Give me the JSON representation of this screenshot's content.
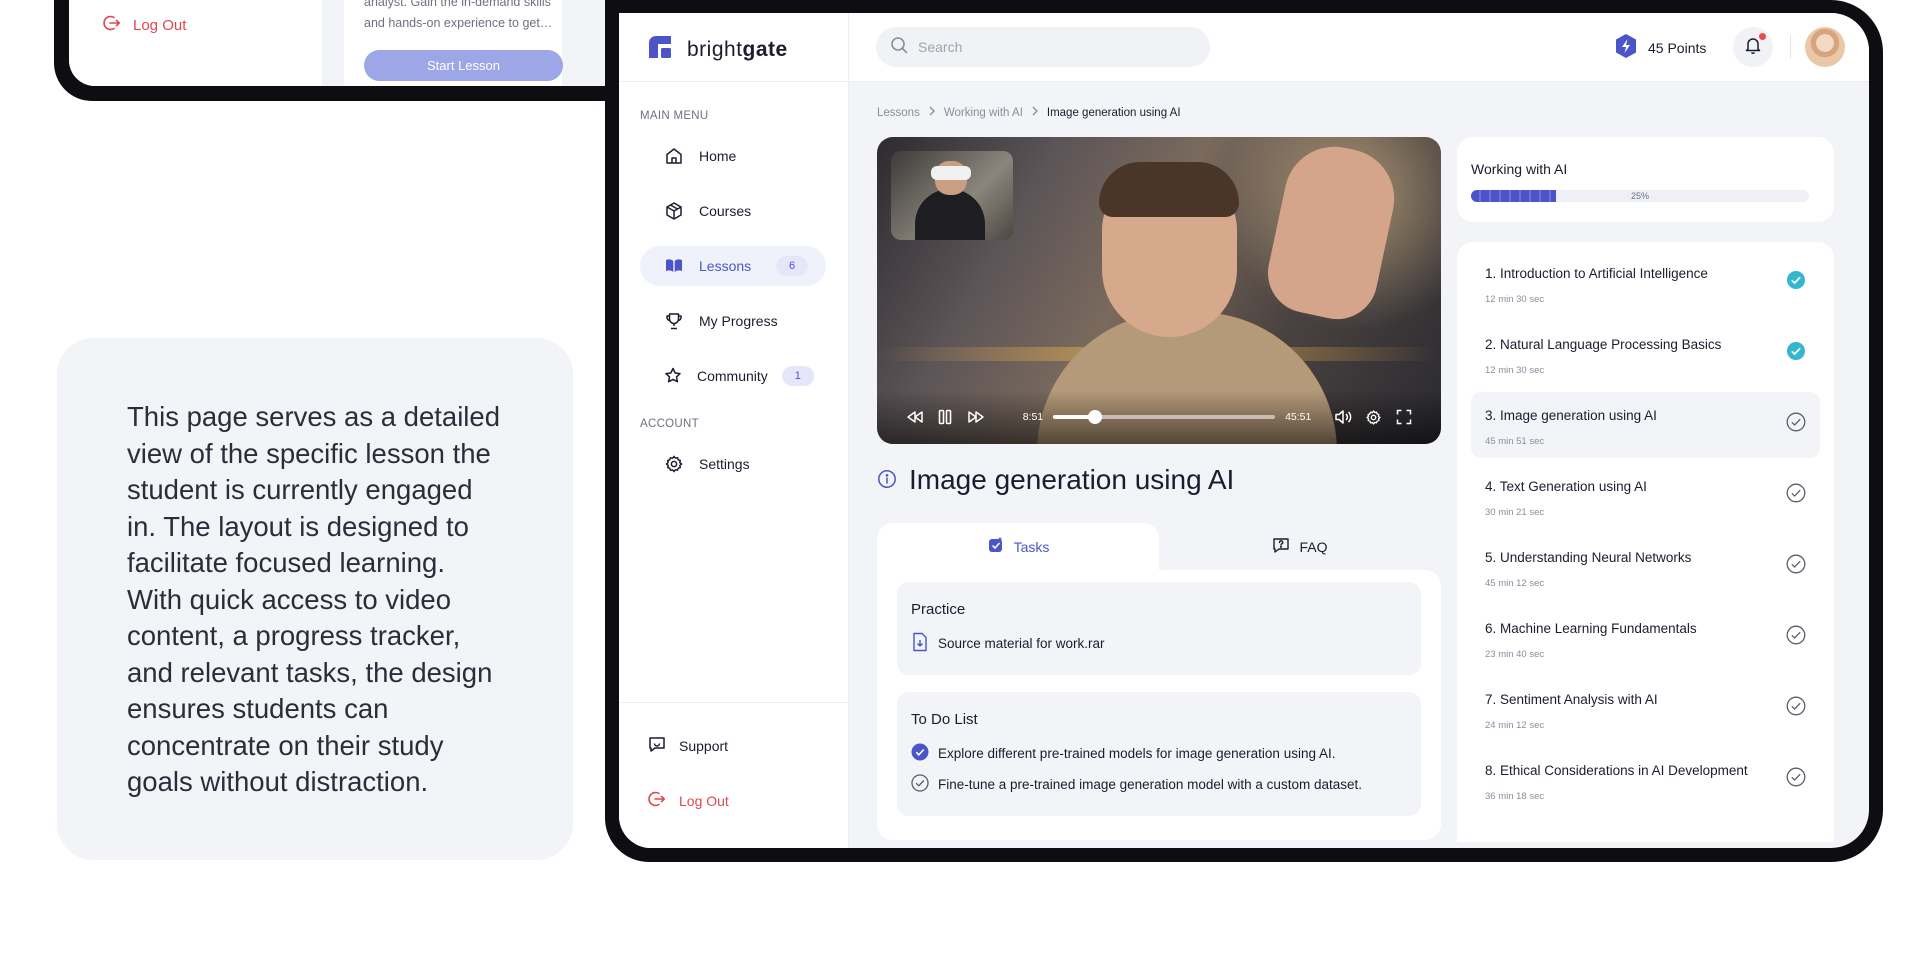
{
  "prev_device": {
    "logout_label": "Log Out",
    "card_text": "analyst. Gain the in-demand skills and hands-on experience to get…",
    "start_button": "Start Lesson"
  },
  "description": "This page serves as a detailed view of the specific lesson the student is currently engaged in. The layout is designed to facilitate focused learning. With quick access to video content, a progress tracker, and relevant tasks, the design ensures students can concentrate on their study goals without distraction.",
  "app": {
    "brand_light": "bright",
    "brand_bold": "gate",
    "accent": "#4b55c8",
    "danger": "#e0464f",
    "success": "#35b6cf",
    "points": "45 Points"
  },
  "sidebar": {
    "main_menu_label": "MAIN MENU",
    "account_label": "ACCOUNT",
    "items": [
      {
        "label": "Home",
        "icon": "home-icon"
      },
      {
        "label": "Courses",
        "icon": "box-icon"
      },
      {
        "label": "Lessons",
        "icon": "book-icon",
        "badge": "6",
        "active": true
      },
      {
        "label": "My Progress",
        "icon": "trophy-icon"
      },
      {
        "label": "Community",
        "icon": "community-icon",
        "badge": "1"
      }
    ],
    "settings": "Settings",
    "support": "Support",
    "logout": "Log Out"
  },
  "search": {
    "placeholder": "Search",
    "value": ""
  },
  "breadcrumb": [
    "Lessons",
    "Working with AI",
    "Image generation using AI"
  ],
  "video": {
    "elapsed": "8:51",
    "total": "45:51",
    "progress": 0.19
  },
  "lesson_title": "Image generation using AI",
  "tabs": {
    "tasks": "Tasks",
    "faq": "FAQ"
  },
  "practice": {
    "title": "Practice",
    "file": "Source material for work.rar"
  },
  "todo": {
    "title": "To Do List",
    "items": [
      {
        "text": "Explore different pre-trained models for image generation using AI.",
        "done": true
      },
      {
        "text": "Fine-tune a pre-trained image generation model with a custom dataset.",
        "done": false
      }
    ]
  },
  "course_progress": {
    "title": "Working with AI",
    "percent_label": "25%",
    "percent": 0.25
  },
  "lessons": [
    {
      "title": "1. Introduction to Artificial Intelligence",
      "duration": "12 min 30 sec",
      "status": "done"
    },
    {
      "title": "2. Natural Language Processing Basics",
      "duration": "12 min 30 sec",
      "status": "done"
    },
    {
      "title": "3. Image generation using AI",
      "duration": "45 min 51 sec",
      "status": "current"
    },
    {
      "title": "4. Text Generation using AI",
      "duration": "30 min 21 sec",
      "status": "todo"
    },
    {
      "title": "5. Understanding Neural Networks",
      "duration": "45 min 12 sec",
      "status": "todo"
    },
    {
      "title": "6. Machine Learning Fundamentals",
      "duration": "23 min 40 sec",
      "status": "todo"
    },
    {
      "title": "7. Sentiment Analysis with AI",
      "duration": "24 min 12 sec",
      "status": "todo"
    },
    {
      "title": "8. Ethical Considerations in AI Development",
      "duration": "36 min 18 sec",
      "status": "todo"
    }
  ]
}
